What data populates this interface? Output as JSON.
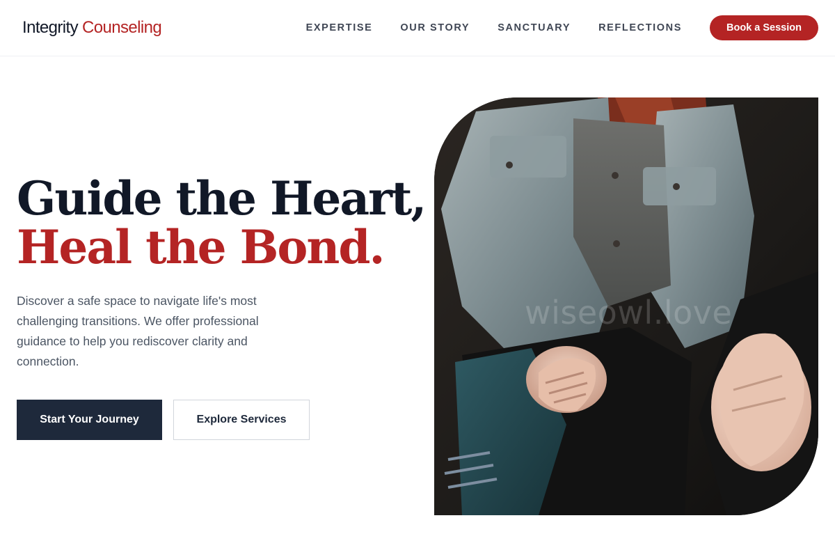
{
  "brand": {
    "first": "Integrity",
    "second": "Counseling"
  },
  "nav": {
    "items": [
      {
        "label": "EXPERTISE"
      },
      {
        "label": "OUR STORY"
      },
      {
        "label": "SANCTUARY"
      },
      {
        "label": "REFLECTIONS"
      }
    ],
    "cta_label": "Book a Session"
  },
  "hero": {
    "title_line1": "Guide the Heart,",
    "title_line2": "Heal the Bond.",
    "description": "Discover a safe space to navigate life's most challenging transitions. We offer professional guidance to help you rediscover clarity and connection.",
    "primary_button": "Start Your Journey",
    "secondary_button": "Explore Services",
    "image_watermark": "wiseowl.love"
  },
  "colors": {
    "accent": "#b42424",
    "dark": "#1e293b",
    "text_muted": "#4b5563"
  }
}
